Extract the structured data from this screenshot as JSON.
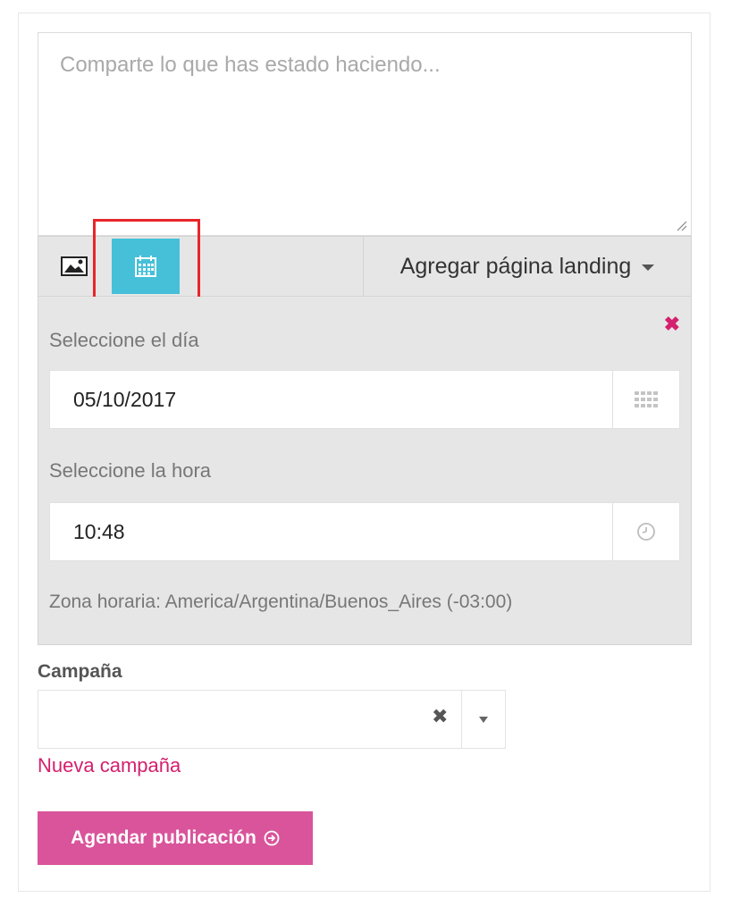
{
  "composer": {
    "placeholder": "Comparte lo que has estado haciendo...",
    "value": ""
  },
  "toolbar": {
    "image_icon": "image-icon",
    "calendar_icon": "calendar-icon",
    "landing_dropdown_label": "Agregar página landing",
    "active_color": "#45c0d8"
  },
  "schedule": {
    "close_symbol": "✖",
    "day_label": "Seleccione el día",
    "day_value": "05/10/2017",
    "hour_label": "Seleccione la hora",
    "hour_value": "10:48",
    "timezone_text": "Zona horaria: America/Argentina/Buenos_Aires (-03:00)",
    "accent_color": "#d4206e"
  },
  "campaign": {
    "label": "Campaña",
    "selected_value": "",
    "clear_symbol": "✖",
    "new_campaign_link": "Nueva campaña"
  },
  "actions": {
    "schedule_button_label": "Agendar publicación",
    "button_color": "#d9549b"
  }
}
